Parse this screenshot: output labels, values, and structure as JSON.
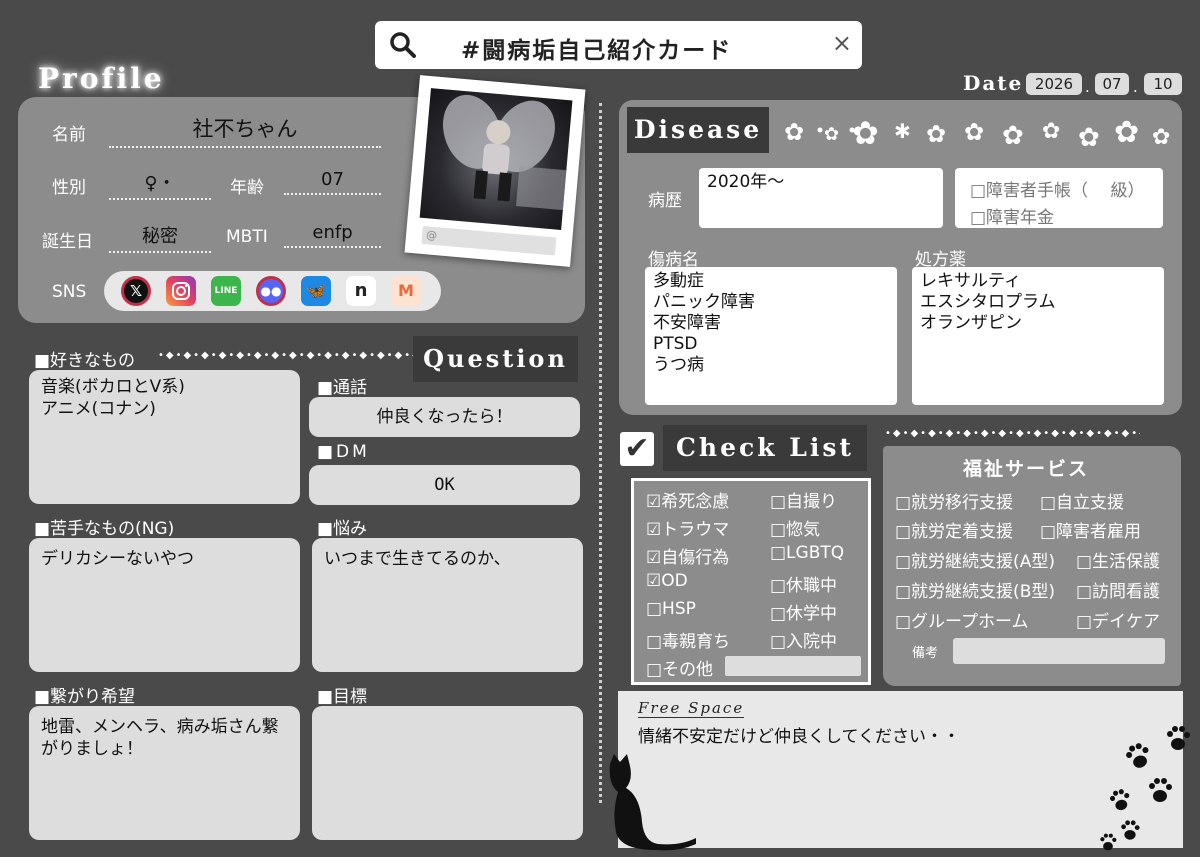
{
  "search": {
    "title": "#闘病垢自己紹介カード",
    "close": "×"
  },
  "profile": {
    "title": "Profile",
    "name_label": "名前",
    "name": "社不ちゃん",
    "gender_label": "性別",
    "gender": "♀・",
    "age_label": "年齢",
    "age": "07",
    "birthday_label": "誕生日",
    "birthday": "秘密",
    "mbti_label": "MBTI",
    "mbti": "enfp",
    "sns_label": "SNS",
    "sns_icons": [
      "x-icon",
      "instagram-icon",
      "line-icon",
      "discord-icon",
      "bluesky-icon",
      "note-icon",
      "misskey-icon"
    ],
    "polaroid_at": "@"
  },
  "date": {
    "label": "Date",
    "year": "2026",
    "month": "07",
    "day": "10",
    "sep": "."
  },
  "likes": {
    "label": "■好きなもの",
    "text": "音楽(ボカロとV系)\nアニメ(コナン)"
  },
  "dislikes": {
    "label": "■苦手なもの(NG)",
    "text": "デリカシーないやつ"
  },
  "connect": {
    "label": "■繋がり希望",
    "text": "地雷、メンヘラ、病み垢さん繋がりましょ！"
  },
  "question": {
    "title": "Question",
    "call_label": "■通話",
    "call": "仲良くなったら！",
    "dm_label": "■DM",
    "dm": "OK",
    "worry_label": "■悩み",
    "worry": "いつまで生きてるのか、",
    "goal_label": "■目標",
    "goal": ""
  },
  "disease": {
    "title": "Disease",
    "history_label": "病歴",
    "history": "2020年～",
    "cert1": "□障害者手帳（　 級）",
    "cert2": "□障害年金",
    "diagnosis_label": "傷病名",
    "diagnosis": "多動症\nパニック障害\n不安障害\nPTSD\nうつ病",
    "meds_label": "処方薬",
    "meds": "レキサルティ\nエスシタロプラム\nオランザピン"
  },
  "checklist": {
    "title": "Check List",
    "left": [
      "☑希死念慮",
      "☑トラウマ",
      "☑自傷行為",
      "☑OD",
      "□HSP",
      "□毒親育ち",
      "□その他"
    ],
    "right": [
      "□自撮り",
      "□惚気",
      "□LGBTQ",
      "□休職中",
      "□休学中",
      "□入院中"
    ]
  },
  "welfare": {
    "title": "福祉サービス",
    "left": [
      "□就労移行支援",
      "□就労定着支援",
      "□就労継続支援(A型)",
      "□就労継続支援(B型)",
      "□グループホーム"
    ],
    "right": [
      "□自立支援",
      "□障害者雇用",
      "□生活保護",
      "□訪問看護",
      "□デイケア"
    ],
    "memo_label": "備考"
  },
  "free": {
    "title": "Free Space",
    "text": "情緒不安定だけど仲良くしてください・・"
  },
  "colors": {
    "bg": "#4a4a4a",
    "panel": "#8c8c8c",
    "box": "#dddddd",
    "header": "#3a3a3a"
  }
}
